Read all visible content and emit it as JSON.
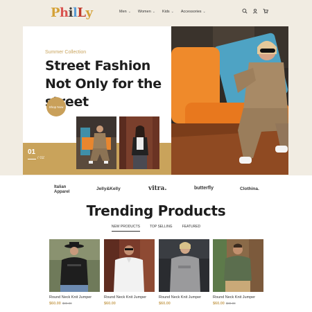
{
  "header": {
    "logo": {
      "letters": [
        "P",
        "h",
        "i",
        "l",
        "L",
        "y"
      ],
      "colors": [
        "#d4a136",
        "#d9534f",
        "#3a3a3a",
        "#5a9bd4",
        "#c0392b",
        "#d4a136"
      ]
    },
    "nav": [
      {
        "label": "Men"
      },
      {
        "label": "Women"
      },
      {
        "label": "Kids"
      },
      {
        "label": "Accessories"
      }
    ],
    "icons": [
      "search-icon",
      "user-icon",
      "cart-icon"
    ]
  },
  "hero": {
    "collection": "Summer Collection",
    "headline": "Street Fashion Not Only for the street",
    "cta": "Shop Now",
    "slide_current": "01",
    "slide_total": "/ 02"
  },
  "brands": [
    "Italian Apparel",
    "Jelly&Kelly",
    "vitra.",
    "butterfly",
    "Clothina."
  ],
  "trending": {
    "title": "Trending Products",
    "tabs": [
      "NEW PRODUCTS",
      "TOP SELLING",
      "FEATURED"
    ],
    "products": [
      {
        "name": "Round Neck Knit Jumper",
        "price": "$60.00",
        "old_price": "$80.00"
      },
      {
        "name": "Round Neck Knit Jumper",
        "price": "$60.00",
        "old_price": ""
      },
      {
        "name": "Round Neck Knit Jumper",
        "price": "$60.00",
        "old_price": ""
      },
      {
        "name": "Round Neck Knit Jumper",
        "price": "$60.00",
        "old_price": "$80.00"
      }
    ]
  },
  "colors": {
    "accent": "#c9a35b",
    "band": "#f1ece2",
    "text": "#1d1d1d"
  }
}
